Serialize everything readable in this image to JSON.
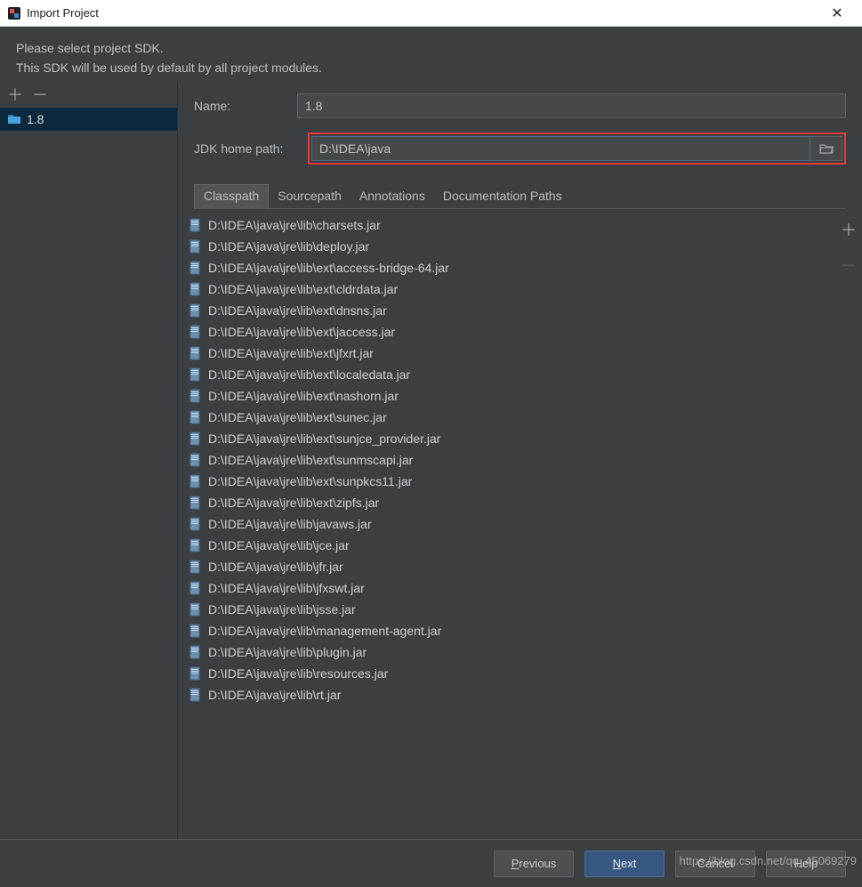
{
  "titlebar": {
    "title": "Import Project"
  },
  "intro": {
    "line1": "Please select project SDK.",
    "line2": "This SDK will be used by default by all project modules."
  },
  "sidebar": {
    "items": [
      {
        "label": "1.8"
      }
    ]
  },
  "form": {
    "name_label": "Name:",
    "name_value": "1.8",
    "jdk_label": "JDK home path:",
    "jdk_value": "D:\\IDEA\\java"
  },
  "tabs": [
    {
      "label": "Classpath",
      "active": true
    },
    {
      "label": "Sourcepath"
    },
    {
      "label": "Annotations"
    },
    {
      "label": "Documentation Paths"
    }
  ],
  "classpath": [
    "D:\\IDEA\\java\\jre\\lib\\charsets.jar",
    "D:\\IDEA\\java\\jre\\lib\\deploy.jar",
    "D:\\IDEA\\java\\jre\\lib\\ext\\access-bridge-64.jar",
    "D:\\IDEA\\java\\jre\\lib\\ext\\cldrdata.jar",
    "D:\\IDEA\\java\\jre\\lib\\ext\\dnsns.jar",
    "D:\\IDEA\\java\\jre\\lib\\ext\\jaccess.jar",
    "D:\\IDEA\\java\\jre\\lib\\ext\\jfxrt.jar",
    "D:\\IDEA\\java\\jre\\lib\\ext\\localedata.jar",
    "D:\\IDEA\\java\\jre\\lib\\ext\\nashorn.jar",
    "D:\\IDEA\\java\\jre\\lib\\ext\\sunec.jar",
    "D:\\IDEA\\java\\jre\\lib\\ext\\sunjce_provider.jar",
    "D:\\IDEA\\java\\jre\\lib\\ext\\sunmscapi.jar",
    "D:\\IDEA\\java\\jre\\lib\\ext\\sunpkcs11.jar",
    "D:\\IDEA\\java\\jre\\lib\\ext\\zipfs.jar",
    "D:\\IDEA\\java\\jre\\lib\\javaws.jar",
    "D:\\IDEA\\java\\jre\\lib\\jce.jar",
    "D:\\IDEA\\java\\jre\\lib\\jfr.jar",
    "D:\\IDEA\\java\\jre\\lib\\jfxswt.jar",
    "D:\\IDEA\\java\\jre\\lib\\jsse.jar",
    "D:\\IDEA\\java\\jre\\lib\\management-agent.jar",
    "D:\\IDEA\\java\\jre\\lib\\plugin.jar",
    "D:\\IDEA\\java\\jre\\lib\\resources.jar",
    "D:\\IDEA\\java\\jre\\lib\\rt.jar"
  ],
  "footer": {
    "previous": "Previous",
    "next": "Next",
    "cancel": "Cancel",
    "help": "Help"
  },
  "watermark": "https://blog.csdn.net/qq_45069279"
}
